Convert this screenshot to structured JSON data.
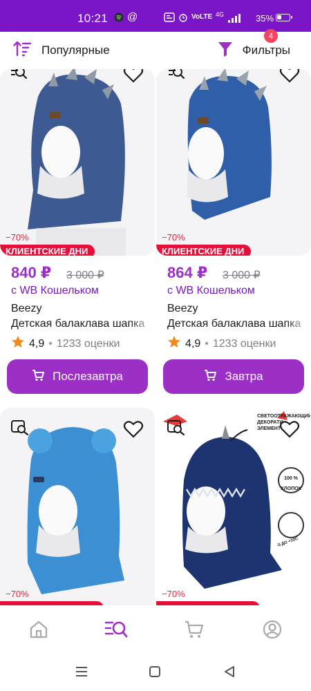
{
  "status_bar": {
    "time": "10:21",
    "battery": "35%",
    "network": "4G"
  },
  "toolbar": {
    "sort_label": "Популярные",
    "filters_label": "Фильтры",
    "filters_count": "4"
  },
  "products": [
    {
      "discount": "−70%",
      "promo": "КЛИЕНТСКИЕ ДНИ",
      "price": "840 ₽",
      "old_price": "3 000 ₽",
      "wallet": "с WB Кошельком",
      "brand": "Beezy",
      "title": "Детская балаклава шапка",
      "rating": "4,9",
      "reviews": "1233 оценки",
      "button": "Послезавтра",
      "hat_color": "#3d5a92",
      "spike_color": "#8f9aa6"
    },
    {
      "discount": "−70%",
      "promo": "КЛИЕНТСКИЕ ДНИ",
      "price": "864 ₽",
      "old_price": "3 000 ₽",
      "wallet": "с WB Кошельком",
      "brand": "Beezy",
      "title": "Детская балаклава шапка",
      "rating": "4,9",
      "reviews": "1233 оценки",
      "button": "Завтра",
      "hat_color": "#2f5fa8",
      "spike_color": "#9aa3ad"
    },
    {
      "discount": "−70%",
      "hat_color": "#3d8fd4",
      "pompom_color": "#4aa3e0"
    },
    {
      "discount": "−70%",
      "hat_color": "#1e3470",
      "labels": [
        "СВЕТООТРАЖАЮЩИЙ",
        "ДЕКОРАТИ",
        "ЭЛЕМЕНТ"
      ],
      "badge_cotton": [
        "100 %",
        "ХЛОПОК"
      ],
      "badge_temp": "-5 ДО +10С"
    }
  ],
  "colors": {
    "accent": "#7a16c8",
    "button": "#9b2fc6",
    "promo": "#e4103a",
    "discount": "#e4243d",
    "star": "#f08a1a"
  }
}
